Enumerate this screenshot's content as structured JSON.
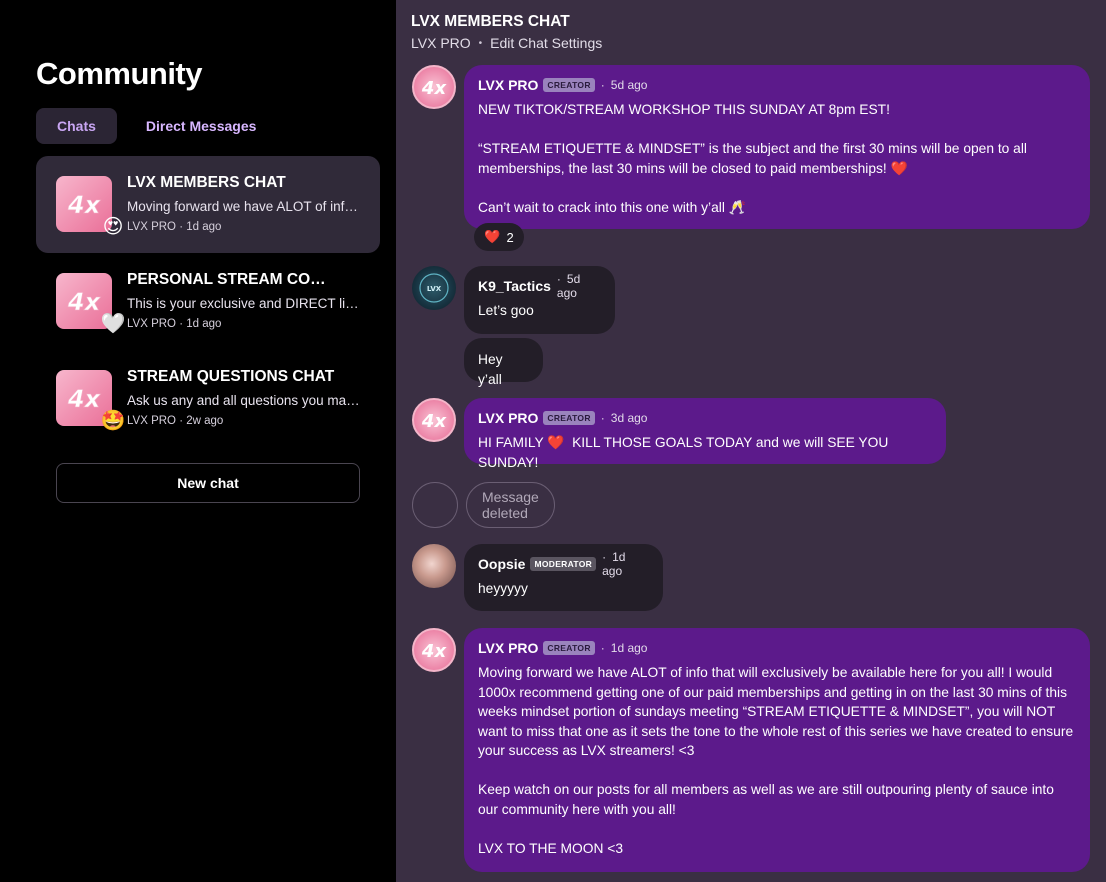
{
  "sidebar": {
    "title": "Community",
    "tabs": [
      {
        "label": "Chats"
      },
      {
        "label": "Direct Messages"
      }
    ],
    "chats": [
      {
        "title": "LVX MEMBERS CHAT",
        "preview": "Moving forward we have ALOT of info that will exclusively be available here for you all!",
        "author": "LVX PRO",
        "time": "1d ago",
        "badge": "😍"
      },
      {
        "title": "PERSONAL STREAM COACHING",
        "preview": "This is your exclusive and DIRECT line to us",
        "author": "LVX PRO",
        "time": "1d ago",
        "badge": "🤍"
      },
      {
        "title": "STREAM QUESTIONS CHAT",
        "preview": "Ask us any and all questions you may have",
        "author": "LVX PRO",
        "time": "2w ago",
        "badge": "🤩"
      }
    ],
    "new_chat_label": "New chat"
  },
  "header": {
    "title": "LVX MEMBERS CHAT",
    "community": "LVX PRO",
    "settings_label": "Edit Chat Settings",
    "separator": "•"
  },
  "messages": [
    {
      "author": "LVX PRO",
      "role": "CREATOR",
      "time": "5d ago",
      "text": "NEW TIKTOK/STREAM WORKSHOP THIS SUNDAY AT 8pm EST!\n\n“STREAM ETIQUETTE & MINDSET” is the subject and the first 30 mins will be open to all memberships, the last 30 mins will be closed to paid memberships! ❤️\n\nCan’t wait to crack into this one with y’all 🥂",
      "reaction": {
        "emoji": "❤️",
        "count": "2"
      }
    },
    {
      "author": "K9_Tactics",
      "time": "5d ago",
      "text": "Let’s goo"
    },
    {
      "text": "Hey y’all"
    },
    {
      "author": "LVX PRO",
      "role": "CREATOR",
      "time": "3d ago",
      "text": "HI FAMILY ❤️  KILL THOSE GOALS TODAY and we will SEE YOU SUNDAY!"
    },
    {
      "deleted_text": "Message deleted"
    },
    {
      "author": "Oopsie",
      "role": "MODERATOR",
      "time": "1d ago",
      "text": "heyyyyy"
    },
    {
      "author": "LVX PRO",
      "role": "CREATOR",
      "time": "1d ago",
      "text": "Moving forward we have ALOT of info that will exclusively be available here for you all! I would 1000x recommend getting one of our paid memberships and getting in on the last 30 mins of this weeks mindset portion of sundays meeting “STREAM ETIQUETTE & MINDSET”, you will NOT want to miss that one as it sets the tone to the whole rest of this series we have created to ensure your success as LVX streamers! <3\n\nKeep watch on our posts for all members as well as we are still outpouring plenty of sauce into our community here with you all!\n\nLVX TO THE MOON <3"
    }
  ],
  "avatar_logo_text": "LVX",
  "colors": {
    "sidebar_bg": "#000000",
    "main_bg": "#3a2f43",
    "creator_bubble": "#5c1a8b",
    "member_bubble": "#231e28",
    "tab_active_text": "#c9a6f3",
    "logo_pink": "#ec84a7"
  }
}
